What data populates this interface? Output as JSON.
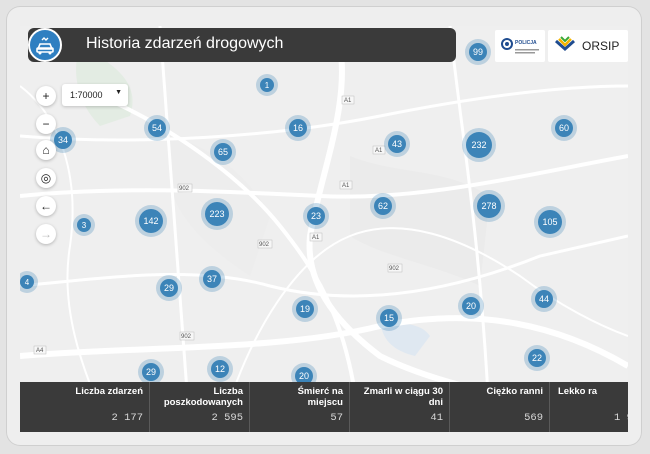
{
  "app": {
    "title": "Historia zdarzeń drogowych"
  },
  "logos": {
    "police_label": "POLICJA",
    "orsip_label": "ORSIP"
  },
  "map": {
    "scale": "1:70000",
    "road_labels": [
      "A1",
      "A1",
      "A1",
      "A1",
      "902",
      "902",
      "902",
      "902",
      "A4"
    ],
    "clusters": [
      "99",
      "1",
      "54",
      "16",
      "34",
      "65",
      "43",
      "232",
      "60",
      "142",
      "223",
      "23",
      "62",
      "278",
      "105",
      "3",
      "37",
      "29",
      "4",
      "19",
      "20",
      "44",
      "15",
      "12",
      "29",
      "20",
      "22"
    ]
  },
  "controls": {
    "zoom_in": "+",
    "zoom_out": "−",
    "home": "⌂",
    "locate": "◎",
    "back": "←",
    "forward": "→"
  },
  "stats": [
    {
      "label": "Liczba zdarzeń",
      "value": "2 177"
    },
    {
      "label": "Liczba poszkodowanych",
      "value": "2 595"
    },
    {
      "label": "Śmierć na miejscu",
      "value": "57"
    },
    {
      "label": "Zmarli w ciągu 30 dni",
      "value": "41"
    },
    {
      "label": "Ciężko ranni",
      "value": "569"
    },
    {
      "label": "Lekko ra",
      "value": "1 9"
    }
  ]
}
